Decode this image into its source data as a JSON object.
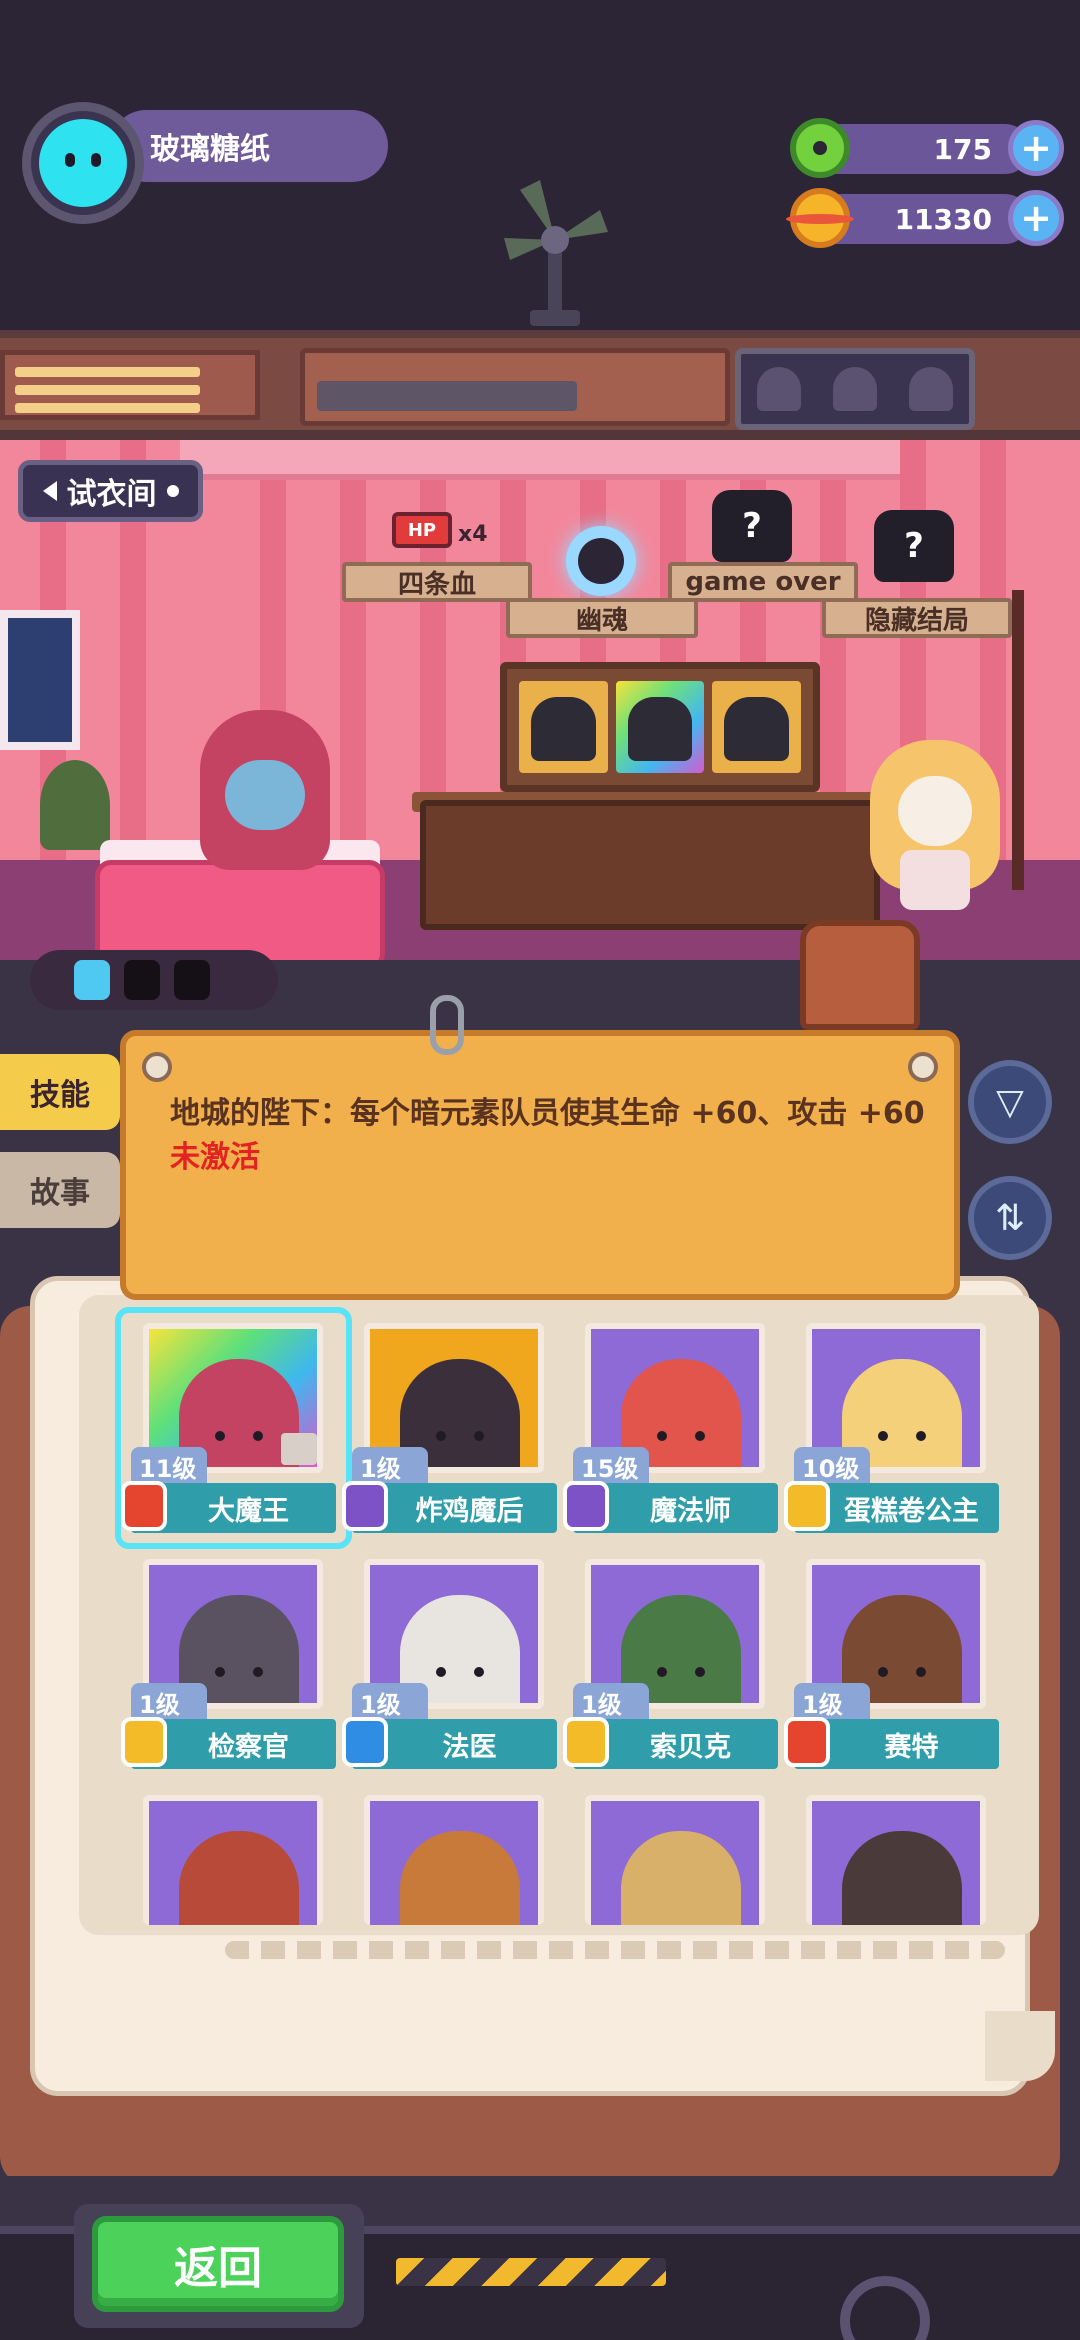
{
  "player": {
    "name": "玻璃糖纸"
  },
  "resources": {
    "donut": {
      "amount": "175",
      "icon": "donut-icon"
    },
    "coin": {
      "amount": "11330",
      "icon": "coin-planet-icon"
    },
    "add_label": "+"
  },
  "room": {
    "fitting_room_label": "试衣间",
    "endings": {
      "four_hp": {
        "label": "四条血",
        "hp_badge": "HP",
        "multiplier": "x4"
      },
      "ghost": {
        "label": "幽魂"
      },
      "game_over": {
        "label": "game over",
        "icon_text": "?"
      },
      "hidden": {
        "label": "隐藏结局",
        "icon_text": "?"
      }
    },
    "energy_slots": [
      true,
      false,
      false
    ]
  },
  "tabs": {
    "skill": "技能",
    "story": "故事"
  },
  "skill": {
    "text": "地城的陛下：每个暗元素队员使其生命 +60、攻击 +60 ",
    "status": "未激活",
    "status_color": "#e32222"
  },
  "controls": {
    "filter_icon": "filter-icon",
    "sort_icon": "sort-icon",
    "filter_glyph": "▽",
    "sort_glyph": "⇅"
  },
  "characters": [
    {
      "name": "大魔王",
      "level": "11级",
      "element": "fire",
      "frame": "rainbow",
      "selected": true,
      "skin": "#c44363",
      "has_outfit": true
    },
    {
      "name": "炸鸡魔后",
      "level": "1级",
      "element": "dark",
      "frame": "gold",
      "selected": false,
      "skin": "#3a2f3a"
    },
    {
      "name": "魔法师",
      "level": "15级",
      "element": "dark",
      "frame": "purple",
      "selected": false,
      "skin": "#e2554c"
    },
    {
      "name": "蛋糕卷公主",
      "level": "10级",
      "element": "light",
      "frame": "purple",
      "selected": false,
      "skin": "#f4d07a"
    },
    {
      "name": "检察官",
      "level": "1级",
      "element": "light",
      "frame": "purple",
      "selected": false,
      "skin": "#5a5260"
    },
    {
      "name": "法医",
      "level": "1级",
      "element": "water",
      "frame": "purple",
      "selected": false,
      "skin": "#e8e4e0"
    },
    {
      "name": "索贝克",
      "level": "1级",
      "element": "light",
      "frame": "purple",
      "selected": false,
      "skin": "#4a7a46"
    },
    {
      "name": "赛特",
      "level": "1级",
      "element": "fire",
      "frame": "purple",
      "selected": false,
      "skin": "#7a4a32"
    }
  ],
  "partial_characters": [
    {
      "skin": "#b84a3a"
    },
    {
      "skin": "#c87a3a"
    },
    {
      "skin": "#d8b06a"
    },
    {
      "skin": "#4a3a3a"
    }
  ],
  "footer": {
    "back_label": "返回"
  }
}
